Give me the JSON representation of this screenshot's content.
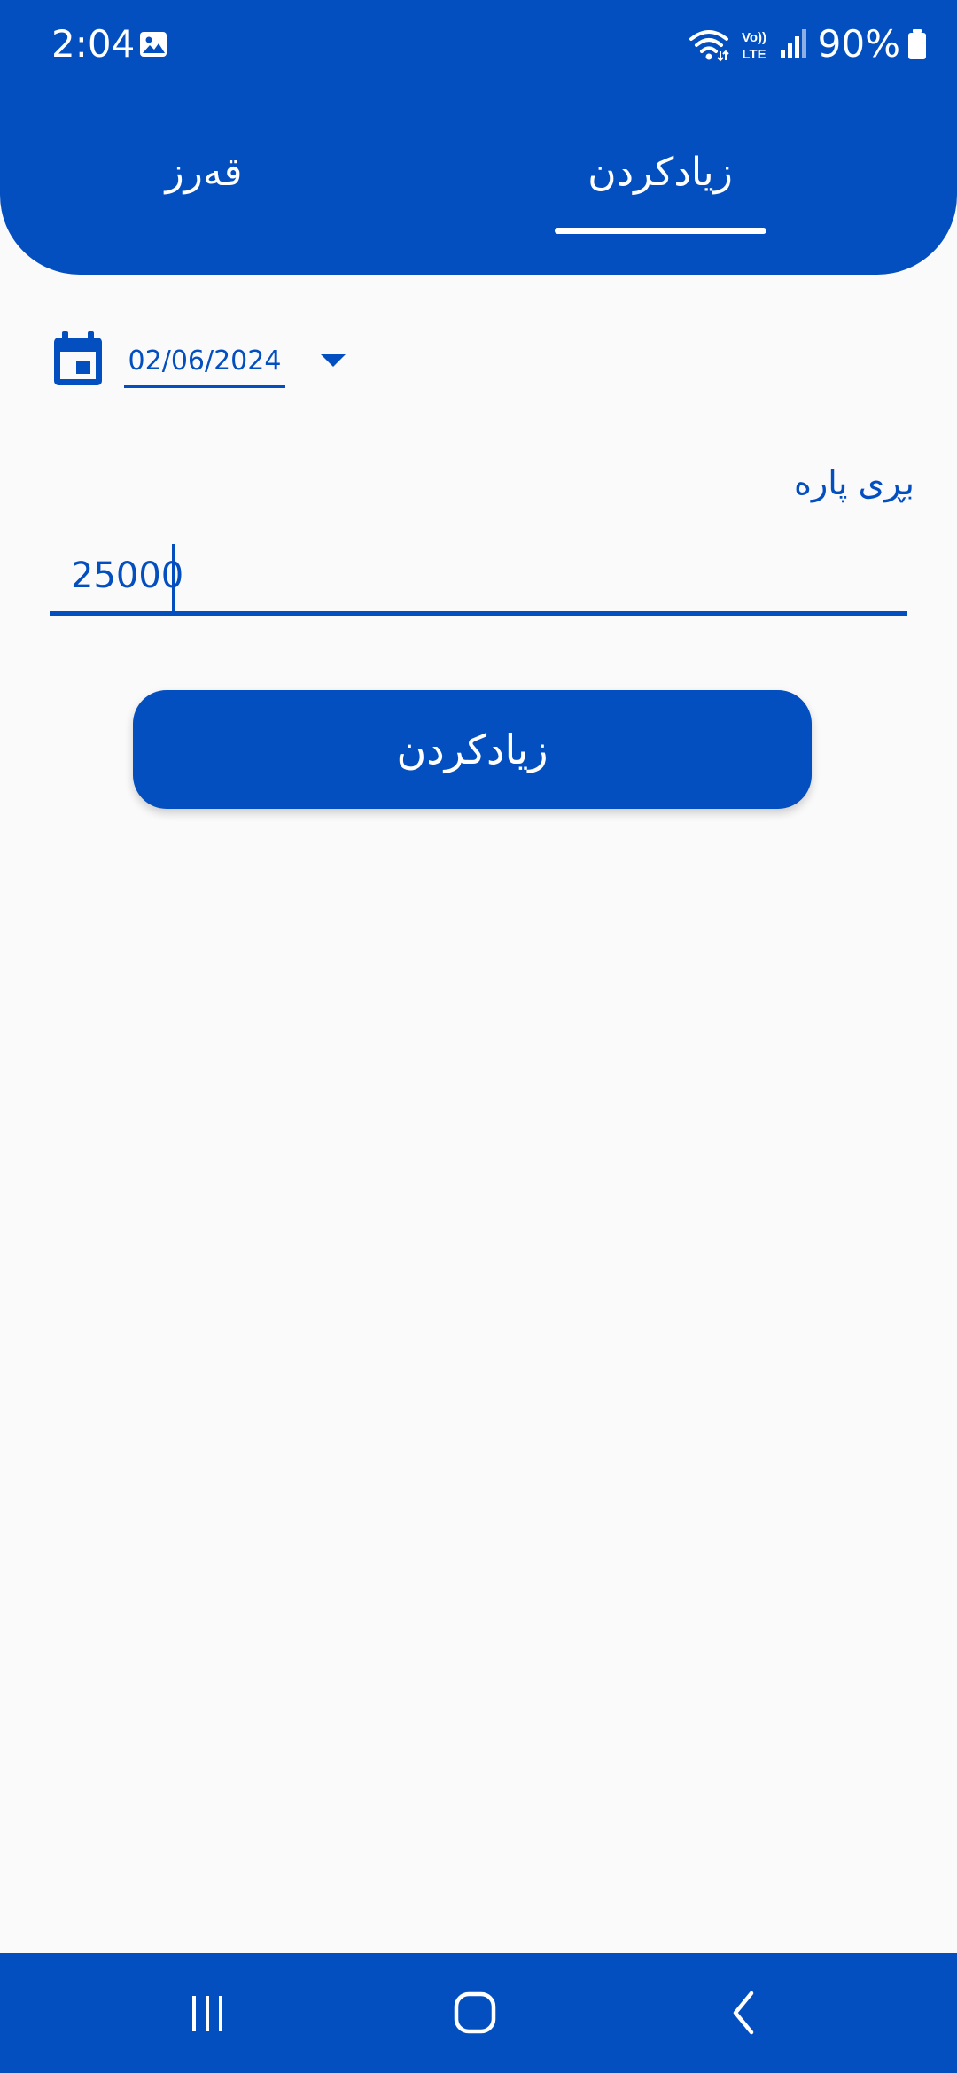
{
  "status_bar": {
    "time": "2:04",
    "battery_percent": "90%",
    "icons": [
      "gallery-icon",
      "wifi-icon",
      "volte-icon",
      "signal-icon",
      "battery-icon"
    ],
    "volte_top": "Vo))",
    "volte_bottom": "LTE"
  },
  "tabs": [
    {
      "label": "زیادکردن",
      "selected": true
    },
    {
      "label": "قەرز",
      "selected": false
    }
  ],
  "date": {
    "icon": "calendar-icon",
    "value": "02/06/2024",
    "dropdown_icon": "caret-down-icon"
  },
  "amount": {
    "label": "بڕی پارە",
    "value": "25000"
  },
  "submit_button": {
    "label": "زیادکردن"
  },
  "nav_bar": {
    "icons": [
      "recents-icon",
      "home-icon",
      "back-icon"
    ]
  },
  "colors": {
    "primary": "#034fc0",
    "background": "#fafafa",
    "on_primary": "#ffffff"
  }
}
